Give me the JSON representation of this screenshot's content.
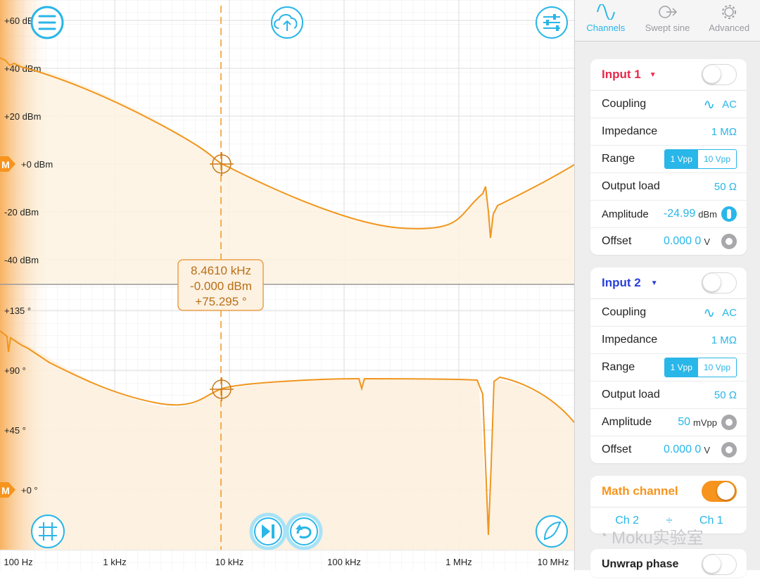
{
  "plot": {
    "mag_labels": [
      "+60 dBm",
      "+40 dBm",
      "+20 dBm",
      "+0 dBm",
      "-20 dBm",
      "-40 dBm"
    ],
    "phase_labels": [
      "+135 °",
      "+90 °",
      "+45 °",
      "+0 °"
    ],
    "freq_labels": [
      "100 Hz",
      "1 kHz",
      "10 kHz",
      "100 kHz",
      "1 MHz",
      "10 MHz"
    ],
    "marker_label": "M",
    "cursor": {
      "freq": "8.4610 kHz",
      "mag": "-0.000 dBm",
      "phase": "+75.295 °"
    },
    "trace_color": "#f0961e",
    "accent": "#29b6e8"
  },
  "tabs": [
    {
      "label": "Channels",
      "icon": "sine-wave-icon"
    },
    {
      "label": "Swept sine",
      "icon": "sweep-arrow-icon"
    },
    {
      "label": "Advanced",
      "icon": "gear-icon"
    }
  ],
  "input1": {
    "title": "Input 1",
    "color": "#e8284a",
    "coupling_label": "Coupling",
    "coupling": "AC",
    "impedance_label": "Impedance",
    "impedance": "1 MΩ",
    "range_label": "Range",
    "range_opt1": "1 Vpp",
    "range_opt2": "10 Vpp",
    "load_label": "Output load",
    "load": "50 Ω",
    "amp_label": "Amplitude",
    "amp": "-24.99",
    "amp_unit": "dBm",
    "offset_label": "Offset",
    "offset": "0.000 0",
    "offset_unit": "V"
  },
  "input2": {
    "title": "Input 2",
    "color": "#2a3fd9",
    "coupling_label": "Coupling",
    "coupling": "AC",
    "impedance_label": "Impedance",
    "impedance": "1 MΩ",
    "range_label": "Range",
    "range_opt1": "1 Vpp",
    "range_opt2": "10 Vpp",
    "load_label": "Output load",
    "load": "50 Ω",
    "amp_label": "Amplitude",
    "amp": "50",
    "amp_unit": "mVpp",
    "offset_label": "Offset",
    "offset": "0.000 0",
    "offset_unit": "V"
  },
  "math": {
    "title": "Math channel",
    "ch_a": "Ch 2",
    "op": "÷",
    "ch_b": "Ch 1"
  },
  "unwrap": {
    "title": "Unwrap phase"
  },
  "watermark": "Moku实验室"
}
